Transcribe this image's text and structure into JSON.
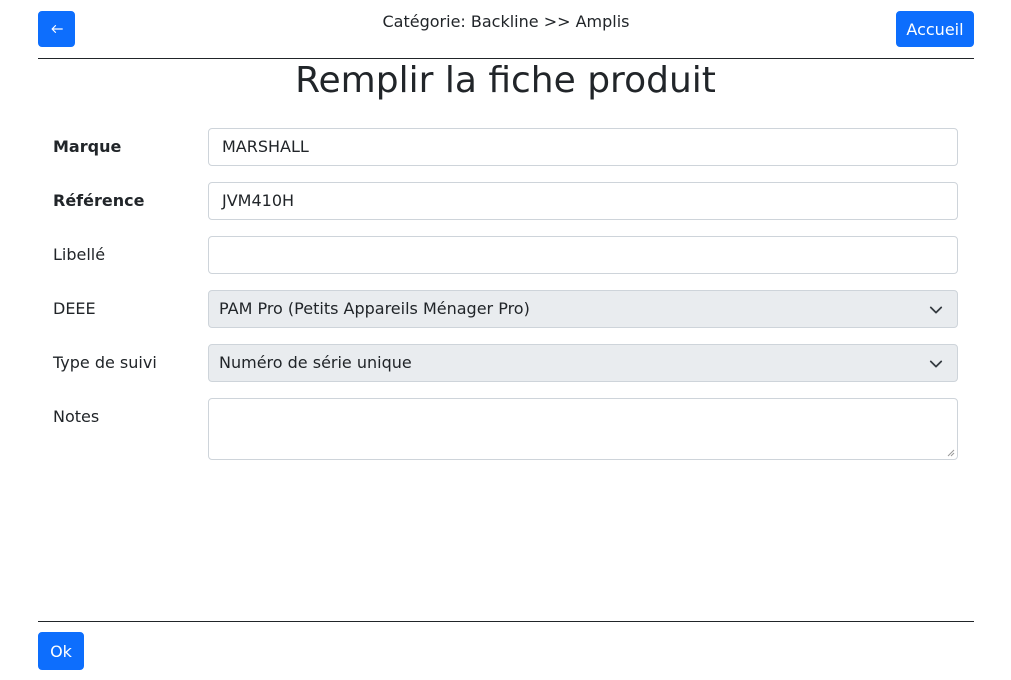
{
  "header": {
    "back_icon": "arrow-left-icon",
    "category": "Catégorie: Backline >> Amplis",
    "home_label": "Accueil"
  },
  "title": "Remplir la fiche produit",
  "form": {
    "brand": {
      "label": "Marque",
      "value": "MARSHALL"
    },
    "reference": {
      "label": "Référence",
      "value": "JVM410H"
    },
    "name": {
      "label": "Libellé",
      "value": ""
    },
    "deee": {
      "label": "DEEE",
      "value": "PAM Pro (Petits Appareils Ménager Pro)"
    },
    "tracking": {
      "label": "Type de suivi",
      "value": "Numéro de série unique"
    },
    "notes": {
      "label": "Notes",
      "value": ""
    }
  },
  "footer": {
    "ok_label": "Ok"
  },
  "colors": {
    "primary": "#0d6efd",
    "select_bg": "#e9ecef",
    "border": "#ced4da"
  }
}
